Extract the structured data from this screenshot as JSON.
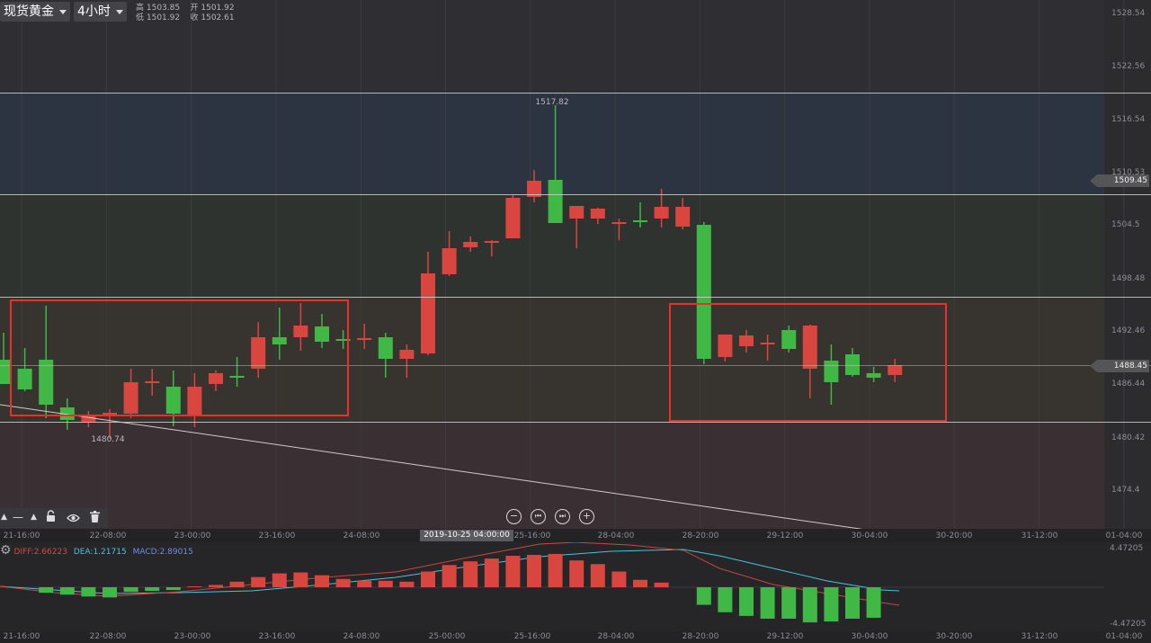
{
  "toolbar": {
    "symbol": "现货黄金",
    "interval": "4小时",
    "ohlc_row1": "高 1503.85    开 1501.92",
    "ohlc_row2": "低 1501.92    收 1502.61"
  },
  "price_axis": [
    "1528.54",
    "1522.56",
    "1516.54",
    "1510.53",
    "1504.5",
    "1498.48",
    "1492.46",
    "1486.44",
    "1480.42",
    "1474.4"
  ],
  "price_markers": {
    "upper": "1509.45",
    "current": "1488.45"
  },
  "annotations": {
    "high": "1517.82",
    "low": "1480.74"
  },
  "time_axis": [
    "21-16:00",
    "22-08:00",
    "23-00:00",
    "23-16:00",
    "24-08:00",
    "25-00:00",
    "25-16:00",
    "28-04:00",
    "28-20:00",
    "29-12:00",
    "30-04:00",
    "30-20:00",
    "31-12:00",
    "01-04:00"
  ],
  "crosshair_date": "2019-10-25 04:00:00",
  "macd_legend": {
    "diff": "DIFF:2.66223",
    "dea": "DEA:1.21715",
    "macd": "MACD:2.89015"
  },
  "macd_axis": {
    "top": "4.47205",
    "bottom": "-4.47205"
  },
  "colors": {
    "up": "#d9453f",
    "down": "#3fb845",
    "box": "#e8312b"
  },
  "icons": [
    "triangle-up-icon",
    "line-tool-icon",
    "lock-icon",
    "eye-icon",
    "trash-icon",
    "zoom-out-icon",
    "rewind-icon",
    "forward-icon",
    "zoom-in-icon",
    "gear-icon"
  ],
  "chart_data": {
    "type": "candlestick",
    "ylim": [
      1470.5,
      1529.5
    ],
    "candles": [
      {
        "o": 1489.5,
        "h": 1492.5,
        "l": 1487.0,
        "c": 1486.8
      },
      {
        "o": 1488.5,
        "h": 1490.8,
        "l": 1486.0,
        "c": 1486.2
      },
      {
        "o": 1489.5,
        "h": 1495.5,
        "l": 1483.0,
        "c": 1484.5
      },
      {
        "o": 1484.2,
        "h": 1485.2,
        "l": 1481.7,
        "c": 1482.8
      },
      {
        "o": 1482.6,
        "h": 1483.8,
        "l": 1482.0,
        "c": 1483.3
      },
      {
        "o": 1483.4,
        "h": 1484.0,
        "l": 1480.7,
        "c": 1483.6
      },
      {
        "o": 1483.5,
        "h": 1488.5,
        "l": 1483.0,
        "c": 1487.0
      },
      {
        "o": 1487.0,
        "h": 1488.5,
        "l": 1485.5,
        "c": 1487.1
      },
      {
        "o": 1486.5,
        "h": 1488.3,
        "l": 1482.1,
        "c": 1483.5
      },
      {
        "o": 1483.3,
        "h": 1488.0,
        "l": 1482.0,
        "c": 1486.5
      },
      {
        "o": 1486.8,
        "h": 1488.3,
        "l": 1486.0,
        "c": 1488.0
      },
      {
        "o": 1487.7,
        "h": 1489.8,
        "l": 1486.5,
        "c": 1487.5
      },
      {
        "o": 1488.5,
        "h": 1493.7,
        "l": 1487.5,
        "c": 1492.0
      },
      {
        "o": 1492.0,
        "h": 1495.3,
        "l": 1489.5,
        "c": 1491.2
      },
      {
        "o": 1492.0,
        "h": 1495.8,
        "l": 1490.5,
        "c": 1493.3
      },
      {
        "o": 1493.2,
        "h": 1494.6,
        "l": 1490.8,
        "c": 1491.5
      },
      {
        "o": 1491.8,
        "h": 1492.8,
        "l": 1490.7,
        "c": 1491.6
      },
      {
        "o": 1491.8,
        "h": 1493.5,
        "l": 1490.7,
        "c": 1491.9
      },
      {
        "o": 1492.0,
        "h": 1492.5,
        "l": 1487.5,
        "c": 1489.6
      },
      {
        "o": 1489.6,
        "h": 1491.2,
        "l": 1487.5,
        "c": 1490.6
      },
      {
        "o": 1490.2,
        "h": 1501.5,
        "l": 1490.0,
        "c": 1499.1
      },
      {
        "o": 1499.0,
        "h": 1503.8,
        "l": 1498.8,
        "c": 1501.9
      },
      {
        "o": 1502.0,
        "h": 1503.2,
        "l": 1501.5,
        "c": 1502.6
      },
      {
        "o": 1502.7,
        "h": 1502.8,
        "l": 1501.0,
        "c": 1502.7
      },
      {
        "o": 1503.0,
        "h": 1507.8,
        "l": 1503.0,
        "c": 1507.5
      },
      {
        "o": 1507.6,
        "h": 1510.6,
        "l": 1507.0,
        "c": 1509.4
      },
      {
        "o": 1509.5,
        "h": 1517.8,
        "l": 1504.8,
        "c": 1504.7
      },
      {
        "o": 1505.2,
        "h": 1506.2,
        "l": 1501.9,
        "c": 1506.6
      },
      {
        "o": 1505.2,
        "h": 1506.4,
        "l": 1504.6,
        "c": 1506.3
      },
      {
        "o": 1504.8,
        "h": 1505.2,
        "l": 1502.8,
        "c": 1504.8
      },
      {
        "o": 1505.0,
        "h": 1507.0,
        "l": 1504.2,
        "c": 1504.8
      },
      {
        "o": 1505.2,
        "h": 1508.5,
        "l": 1504.2,
        "c": 1506.5
      },
      {
        "o": 1504.3,
        "h": 1507.5,
        "l": 1504.0,
        "c": 1506.5
      },
      {
        "o": 1504.5,
        "h": 1504.8,
        "l": 1489.0,
        "c": 1489.6
      },
      {
        "o": 1489.8,
        "h": 1492.2,
        "l": 1489.3,
        "c": 1492.3
      },
      {
        "o": 1491.0,
        "h": 1492.8,
        "l": 1490.3,
        "c": 1492.2
      },
      {
        "o": 1491.2,
        "h": 1492.3,
        "l": 1489.4,
        "c": 1491.4
      },
      {
        "o": 1492.8,
        "h": 1493.3,
        "l": 1490.3,
        "c": 1490.7
      },
      {
        "o": 1488.5,
        "h": 1493.4,
        "l": 1485.2,
        "c": 1493.3
      },
      {
        "o": 1489.4,
        "h": 1491.2,
        "l": 1484.5,
        "c": 1487.0
      },
      {
        "o": 1490.1,
        "h": 1490.8,
        "l": 1487.6,
        "c": 1487.8
      },
      {
        "o": 1488.0,
        "h": 1488.7,
        "l": 1487.0,
        "c": 1487.5
      },
      {
        "o": 1487.8,
        "h": 1489.6,
        "l": 1487.0,
        "c": 1488.9
      }
    ],
    "macd_histogram": [
      0.0,
      0.0,
      -0.6,
      -0.8,
      -1.0,
      -1.1,
      -0.5,
      -0.4,
      -0.3,
      0.1,
      0.25,
      0.6,
      1.1,
      1.5,
      1.6,
      1.3,
      0.9,
      0.7,
      0.7,
      0.6,
      1.7,
      2.4,
      2.8,
      3.1,
      3.4,
      3.5,
      3.6,
      2.9,
      2.5,
      1.7,
      0.8,
      0.5,
      0.0,
      -1.9,
      -2.7,
      -3.1,
      -3.4,
      -3.4,
      -3.8,
      -3.7,
      -3.4,
      -3.3
    ],
    "macd_ylim": [
      -4.47205,
      4.47205
    ]
  }
}
